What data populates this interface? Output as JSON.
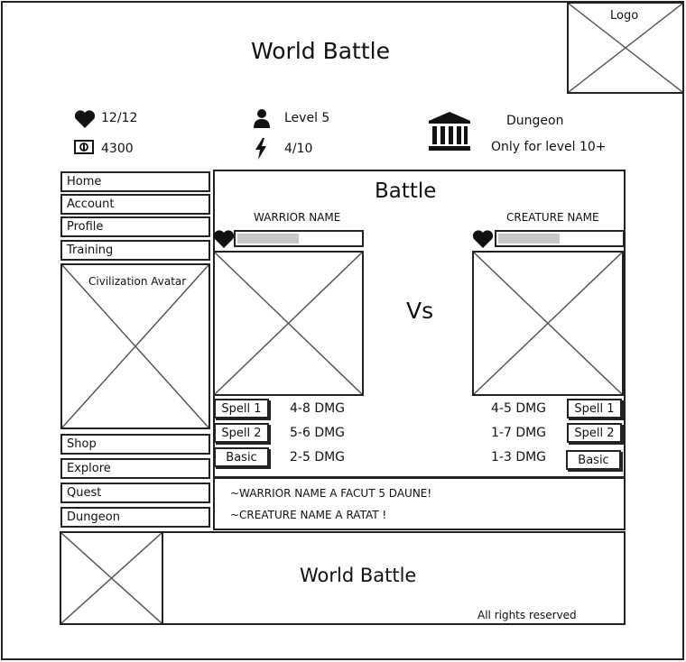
{
  "header": {
    "title": "World Battle",
    "logo_label": "Logo"
  },
  "stats": {
    "health": "12/12",
    "money": "4300",
    "level": "Level 5",
    "energy": "4/10",
    "location": "Dungeon",
    "location_note": "Only for level 10+"
  },
  "nav_top": [
    {
      "label": "Home"
    },
    {
      "label": "Account"
    },
    {
      "label": "Profile"
    },
    {
      "label": "Training"
    }
  ],
  "avatar_label": "Civilization Avatar",
  "nav_bottom": [
    {
      "label": "Shop"
    },
    {
      "label": "Explore"
    },
    {
      "label": "Quest"
    },
    {
      "label": "Dungeon"
    }
  ],
  "battle": {
    "title": "Battle",
    "vs": "Vs",
    "warrior": {
      "name": "WARRIOR NAME",
      "hp_fraction": 0.5,
      "attacks": [
        {
          "button": "Spell 1",
          "dmg": "4-8 DMG"
        },
        {
          "button": "Spell 2",
          "dmg": "5-6 DMG"
        },
        {
          "button": "Basic",
          "dmg": "2-5 DMG"
        }
      ]
    },
    "creature": {
      "name": "CREATURE NAME",
      "hp_fraction": 0.5,
      "attacks": [
        {
          "button": "Spell 1",
          "dmg": "4-5 DMG"
        },
        {
          "button": "Spell 2",
          "dmg": "1-7 DMG"
        },
        {
          "button": "Basic",
          "dmg": "1-3 DMG"
        }
      ]
    },
    "log": [
      "~WARRIOR NAME A FACUT 5 DAUNE!",
      "~CREATURE NAME A RATAT !"
    ]
  },
  "footer": {
    "title": "World Battle",
    "rights": "All rights reserved"
  },
  "colors": {
    "ink": "#222222",
    "hp_fill": "#c8c8c8",
    "background": "#ffffff"
  }
}
